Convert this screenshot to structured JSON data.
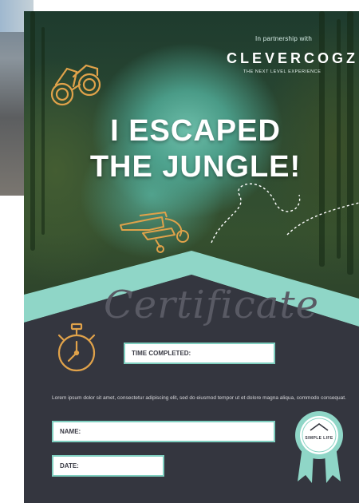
{
  "partner_text": "In partnership with",
  "brand": "CLEVERCOGZ",
  "tagline": "THE NEXT LEVEL EXPERIENCE",
  "headline_line1": "I ESCAPED",
  "headline_line2": "THE JUNGLE!",
  "certificate_word": "Certificate",
  "time_label": "TIME COMPLETED:",
  "body_text": "Lorem ipsum dolor sit amet, consectetur adipiscing elit, sed do eiusmod tempor ut et dolore magna aliqua, commodo consequat.",
  "name_label": "NAME:",
  "date_label": "DATE:",
  "badge_text": "SIMPLE LIFE",
  "icons": [
    "binoculars-icon",
    "biplane-icon",
    "stopwatch-icon",
    "ribbon-badge-icon"
  ],
  "colors": {
    "accent": "#7fcfc0",
    "dark_panel": "#34363f",
    "icon_gold": "#e0a24a"
  }
}
